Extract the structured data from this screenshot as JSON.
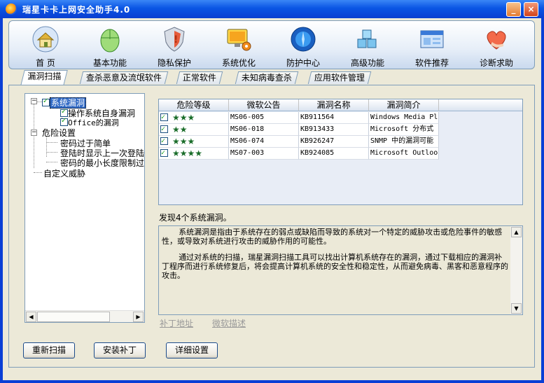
{
  "window": {
    "title": "瑞星卡卡上网安全助手4.0",
    "min_label": "_",
    "close_label": "×"
  },
  "toolbar": {
    "items": [
      {
        "label": "首 页",
        "icon": "home-icon"
      },
      {
        "label": "基本功能",
        "icon": "mouse-icon"
      },
      {
        "label": "隐私保护",
        "icon": "shield-icon"
      },
      {
        "label": "系统优化",
        "icon": "monitor-gear-icon"
      },
      {
        "label": "防护中心",
        "icon": "globe-icon"
      },
      {
        "label": "高级功能",
        "icon": "cubes-icon"
      },
      {
        "label": "软件推荐",
        "icon": "window-icon"
      },
      {
        "label": "诊断求助",
        "icon": "heart-hand-icon"
      }
    ]
  },
  "tabs": [
    {
      "label": "漏洞扫描",
      "active": true
    },
    {
      "label": "查杀恶意及流氓软件"
    },
    {
      "label": "正常软件"
    },
    {
      "label": "未知病毒查杀"
    },
    {
      "label": "应用软件管理"
    }
  ],
  "tree": {
    "root": "系统漏洞",
    "children1": [
      "操作系统自身漏洞",
      "Office的漏洞"
    ],
    "risk": "危险设置",
    "children2": [
      "密码过于简单",
      "登陆时显示上一次登陆",
      "密码的最小长度限制过"
    ],
    "custom": "自定义威胁"
  },
  "grid": {
    "columns": [
      "危险等级",
      "微软公告",
      "漏洞名称",
      "漏洞简介",
      ""
    ],
    "rows": [
      {
        "checked": true,
        "level": "★★★",
        "bulletin": "MS06-005",
        "kb": "KB911564",
        "intro": "Windows Media Pl"
      },
      {
        "checked": true,
        "level": "★★",
        "bulletin": "MS06-018",
        "kb": "KB913433",
        "intro": "Microsoft 分布式"
      },
      {
        "checked": true,
        "level": "★★★",
        "bulletin": "MS06-074",
        "kb": "KB926247",
        "intro": "SNMP 中的漏洞可能"
      },
      {
        "checked": true,
        "level": "★★★★",
        "bulletin": "MS07-003",
        "kb": "KB924085",
        "intro": "Microsoft Outloo"
      }
    ]
  },
  "found_text": "发现4个系统漏洞。",
  "description": {
    "p1": "系统漏洞是指由于系统存在的弱点或缺陷而导致的系统对一个特定的威胁攻击或危险事件的敏感性，或导致对系统进行攻击的威胁作用的可能性。",
    "p2": "通过对系统的扫描，瑞星漏洞扫描工具可以找出计算机系统存在的漏洞，通过下载相应的漏洞补丁程序而进行系统修复后，将会提高计算机系统的安全性和稳定性，从而避免病毒、黑客和恶意程序的攻击。"
  },
  "links": {
    "patch_address": "补丁地址",
    "ms_description": "微软描述"
  },
  "buttons": {
    "rescan": "重新扫描",
    "install_patch": "安装补丁",
    "settings": "详细设置"
  }
}
